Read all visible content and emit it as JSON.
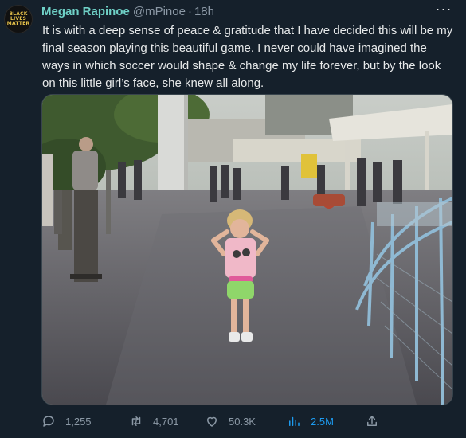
{
  "author": {
    "avatar_text": "BLACK LIVES MATTER",
    "display_name": "Megan Rapinoe",
    "handle": "@mPinoe",
    "separator": "·",
    "time": "18h"
  },
  "more_label": "···",
  "tweet_text": "It is with a deep sense of peace & gratitude that I have decided this will be my final season playing this beautiful game. I never could have imagined the ways in which soccer would shape & change my life forever, but by the look on this little girl’s face, she knew all along.",
  "media": {
    "type": "photo"
  },
  "actions": {
    "replies": "1,255",
    "retweets": "4,701",
    "likes": "50.3K",
    "views": "2.5M"
  },
  "colors": {
    "background": "#15202b",
    "name": "#6fd1c7",
    "muted": "#8b98a5",
    "accent": "#1d9bf0"
  },
  "icons": [
    "reply-icon",
    "retweet-icon",
    "like-icon",
    "views-icon",
    "share-icon"
  ]
}
